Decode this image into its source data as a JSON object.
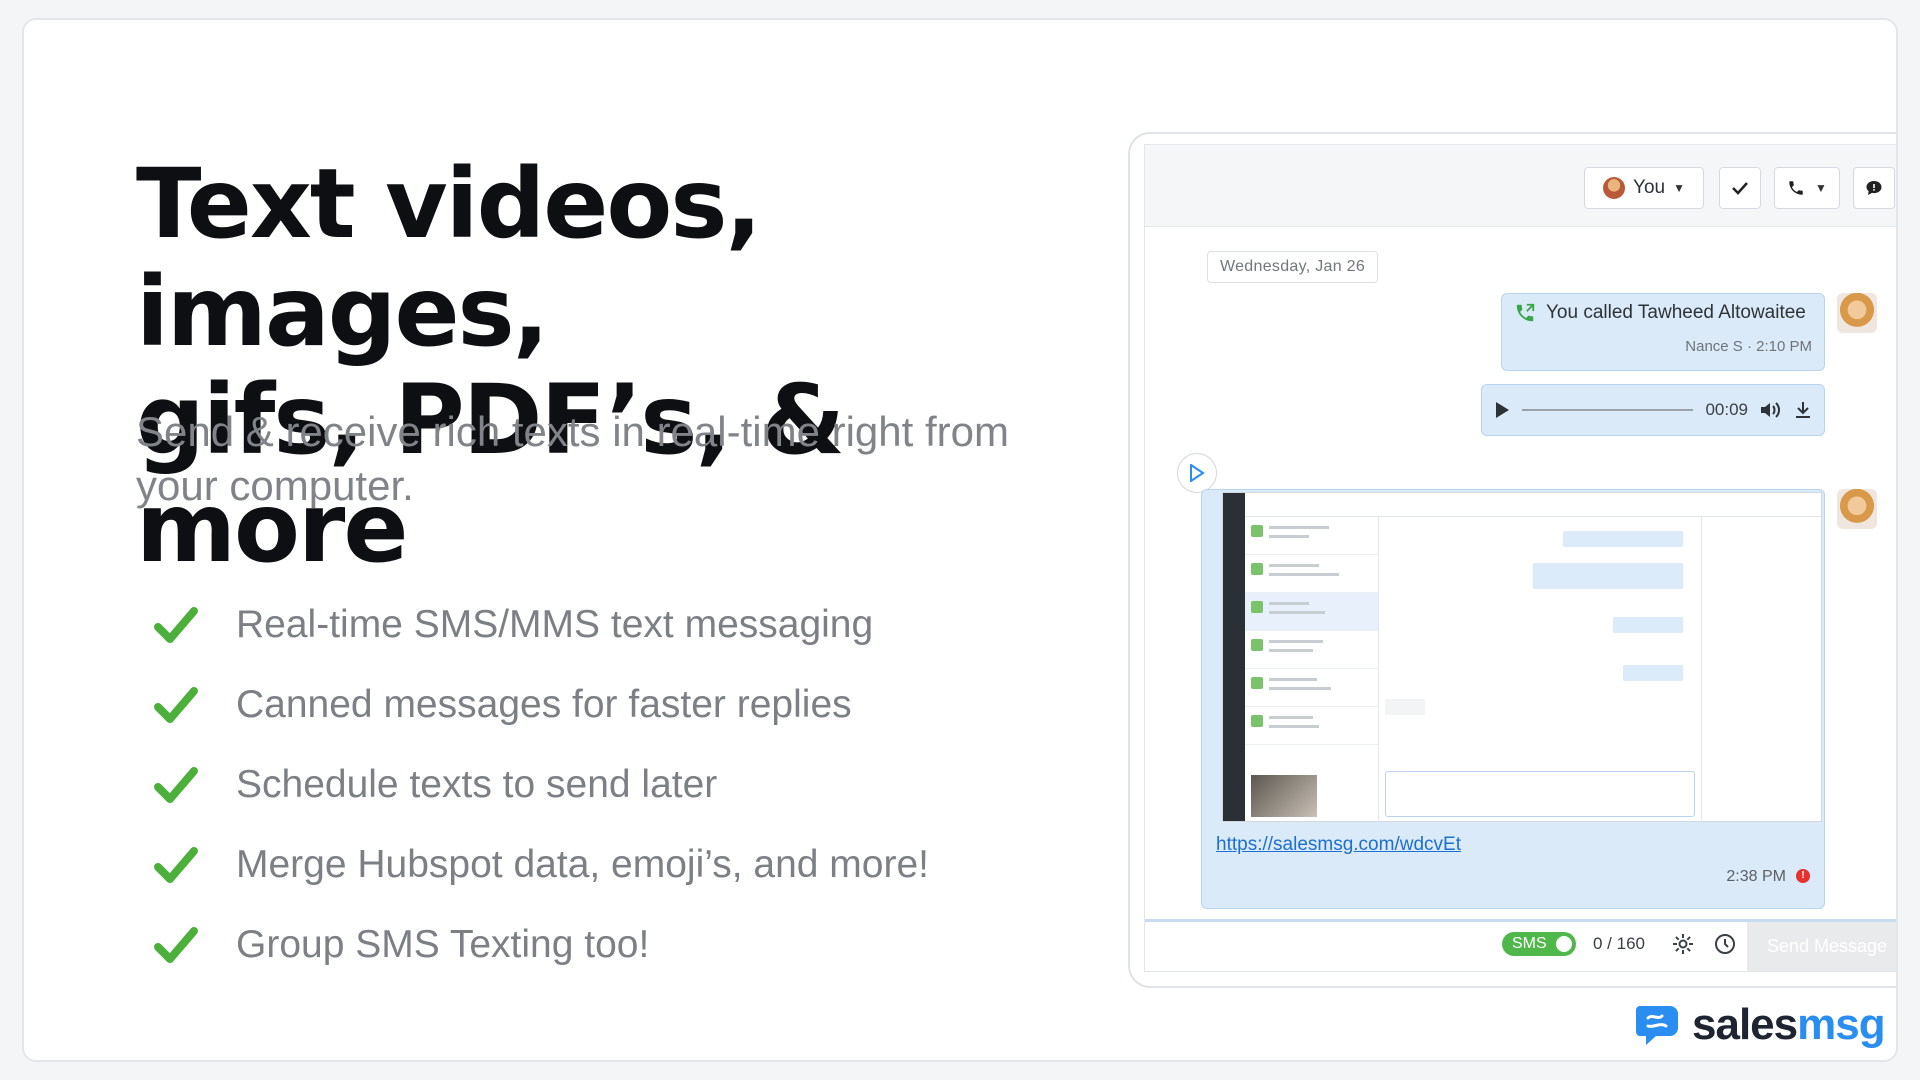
{
  "hero": {
    "headline_line1": "Text videos, images,",
    "headline_line2": "gifs, PDF’s, & more",
    "subhead": "Send & receive rich texts in real-time right from your computer."
  },
  "features": [
    "Real-time SMS/MMS text messaging",
    "Canned messages for faster replies",
    "Schedule texts to send later",
    "Merge Hubspot data, emoji’s, and more!",
    "Group SMS Texting too!"
  ],
  "app": {
    "toolbar": {
      "user_label": "You"
    },
    "date_divider": "Wednesday, Jan 26",
    "call_message": {
      "text": "You called Tawheed Altowaitee",
      "meta": "Nance S · 2:10 PM"
    },
    "audio": {
      "duration": "00:09"
    },
    "media_message": {
      "link": "https://salesmsg.com/wdcvEt",
      "time": "2:38 PM"
    },
    "composer": {
      "sms_label": "SMS",
      "counter": "0 / 160",
      "send_label": "Send Message"
    }
  },
  "brand": {
    "name_part1": "sales",
    "name_part2": "msg"
  },
  "colors": {
    "check": "#4caf3c",
    "accent": "#2a8ef0",
    "bubble": "#dbeaf9",
    "error": "#e5312f"
  }
}
